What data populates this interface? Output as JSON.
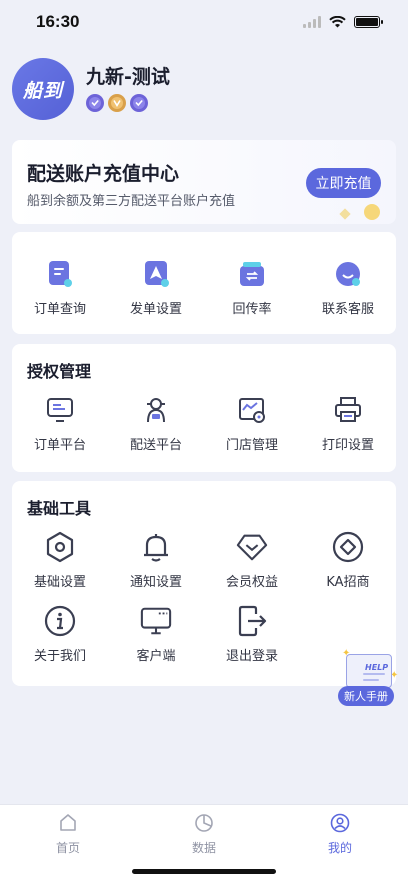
{
  "status_bar": {
    "time": "16:30"
  },
  "profile": {
    "avatar_text": "船到",
    "name": "九新-测试",
    "badges": [
      "verified-badge",
      "gold-badge",
      "verified-badge"
    ]
  },
  "recharge": {
    "title": "配送账户充值中心",
    "subtitle": "船到余额及第三方配送平台账户充值",
    "button_label": "立即充值"
  },
  "quick_actions": [
    {
      "label": "订单查询",
      "icon": "order-query-icon"
    },
    {
      "label": "发单设置",
      "icon": "dispatch-settings-icon"
    },
    {
      "label": "回传率",
      "icon": "return-rate-icon"
    },
    {
      "label": "联系客服",
      "icon": "customer-service-icon"
    }
  ],
  "auth_section": {
    "title": "授权管理",
    "items": [
      {
        "label": "订单平台",
        "icon": "monitor-icon"
      },
      {
        "label": "配送平台",
        "icon": "courier-icon"
      },
      {
        "label": "门店管理",
        "icon": "store-icon"
      },
      {
        "label": "打印设置",
        "icon": "printer-icon"
      }
    ]
  },
  "tools_section": {
    "title": "基础工具",
    "items": [
      {
        "label": "基础设置",
        "icon": "hex-nut-icon"
      },
      {
        "label": "通知设置",
        "icon": "bell-icon"
      },
      {
        "label": "会员权益",
        "icon": "diamond-icon"
      },
      {
        "label": "KA招商",
        "icon": "circle-diamond-icon"
      },
      {
        "label": "关于我们",
        "icon": "info-icon"
      },
      {
        "label": "客户端",
        "icon": "desktop-icon"
      },
      {
        "label": "退出登录",
        "icon": "logout-icon"
      }
    ]
  },
  "help": {
    "paper_text": "HELP",
    "label": "新人手册"
  },
  "tab_bar": {
    "tabs": [
      {
        "label": "首页",
        "icon": "home-icon",
        "active": false
      },
      {
        "label": "数据",
        "icon": "chart-icon",
        "active": false
      },
      {
        "label": "我的",
        "icon": "profile-icon",
        "active": true
      }
    ]
  },
  "colors": {
    "accent": "#5b68dd",
    "background": "#eef0f8"
  }
}
